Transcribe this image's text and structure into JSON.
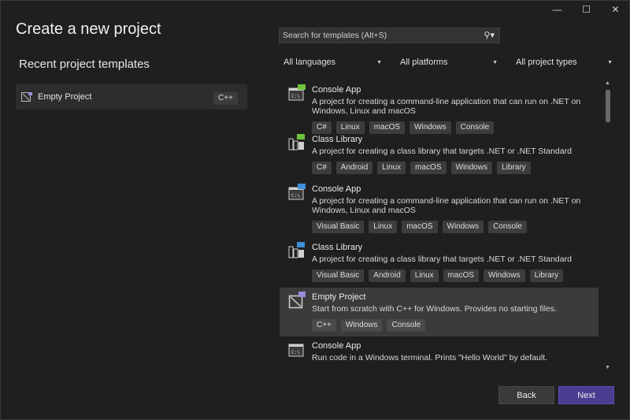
{
  "window": {
    "title": "Create a new project",
    "controls": {
      "minimize": "—",
      "maximize": "☐",
      "close": "✕"
    }
  },
  "recent": {
    "heading": "Recent project templates",
    "items": [
      {
        "label": "Empty Project",
        "tag": "C++",
        "icon": "empty-project-icon"
      }
    ]
  },
  "search": {
    "placeholder": "Search for templates (Alt+S)",
    "value": "",
    "icon": "search-icon"
  },
  "filters": [
    {
      "label": "All languages"
    },
    {
      "label": "All platforms"
    },
    {
      "label": "All project types"
    }
  ],
  "templates": [
    {
      "name": "Console App",
      "description": "A project for creating a command-line application that can run on .NET on Windows, Linux and macOS",
      "tags": [
        "C#",
        "Linux",
        "macOS",
        "Windows",
        "Console"
      ],
      "badge": "C#",
      "icon": "console-app-icon"
    },
    {
      "name": "Class Library",
      "description": "A project for creating a class library that targets .NET or .NET Standard",
      "tags": [
        "C#",
        "Android",
        "Linux",
        "macOS",
        "Windows",
        "Library"
      ],
      "badge": "C#",
      "icon": "class-library-icon"
    },
    {
      "name": "Console App",
      "description": "A project for creating a command-line application that can run on .NET on Windows, Linux and macOS",
      "tags": [
        "Visual Basic",
        "Linux",
        "macOS",
        "Windows",
        "Console"
      ],
      "badge": "VB",
      "icon": "console-app-icon"
    },
    {
      "name": "Class Library",
      "description": "A project for creating a class library that targets .NET or .NET Standard",
      "tags": [
        "Visual Basic",
        "Android",
        "Linux",
        "macOS",
        "Windows",
        "Library"
      ],
      "badge": "VB",
      "icon": "class-library-icon"
    },
    {
      "name": "Empty Project",
      "description": "Start from scratch with C++ for Windows. Provides no starting files.",
      "tags": [
        "C++",
        "Windows",
        "Console"
      ],
      "badge": "++",
      "icon": "empty-project-icon",
      "selected": true
    },
    {
      "name": "Console App",
      "description": "Run code in a Windows terminal. Prints \"Hello World\" by default.",
      "tags": [],
      "badge": "",
      "icon": "console-app-icon"
    }
  ],
  "buttons": {
    "back": "Back",
    "next": "Next"
  },
  "colors": {
    "background": "#1f1f1f",
    "selected": "#3b3b3b",
    "accent": "#4b3c92",
    "csharp": "#6fc33d",
    "vb": "#3d8fd8",
    "cpp": "#9b8bdc"
  }
}
